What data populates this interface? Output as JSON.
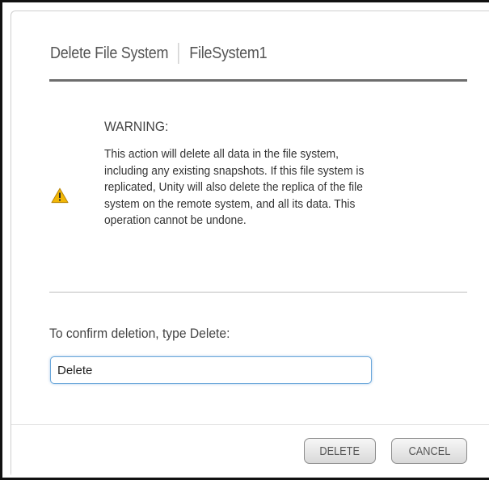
{
  "dialog": {
    "title": "Delete File System",
    "subject": "FileSystem1"
  },
  "warning": {
    "icon": "warning-triangle-icon",
    "icon_color": "#f2b705",
    "heading": "WARNING:",
    "lines": [
      "This action will delete all data in the file system,",
      "including any existing snapshots. If this file system is",
      "replicated, Unity will also delete the replica of the file",
      "system on the remote system, and all its data. This",
      "operation cannot be undone."
    ]
  },
  "confirm": {
    "label": "To confirm deletion, type Delete:",
    "value": "Delete"
  },
  "buttons": {
    "delete_label": "DELETE",
    "cancel_label": "CANCEL"
  }
}
